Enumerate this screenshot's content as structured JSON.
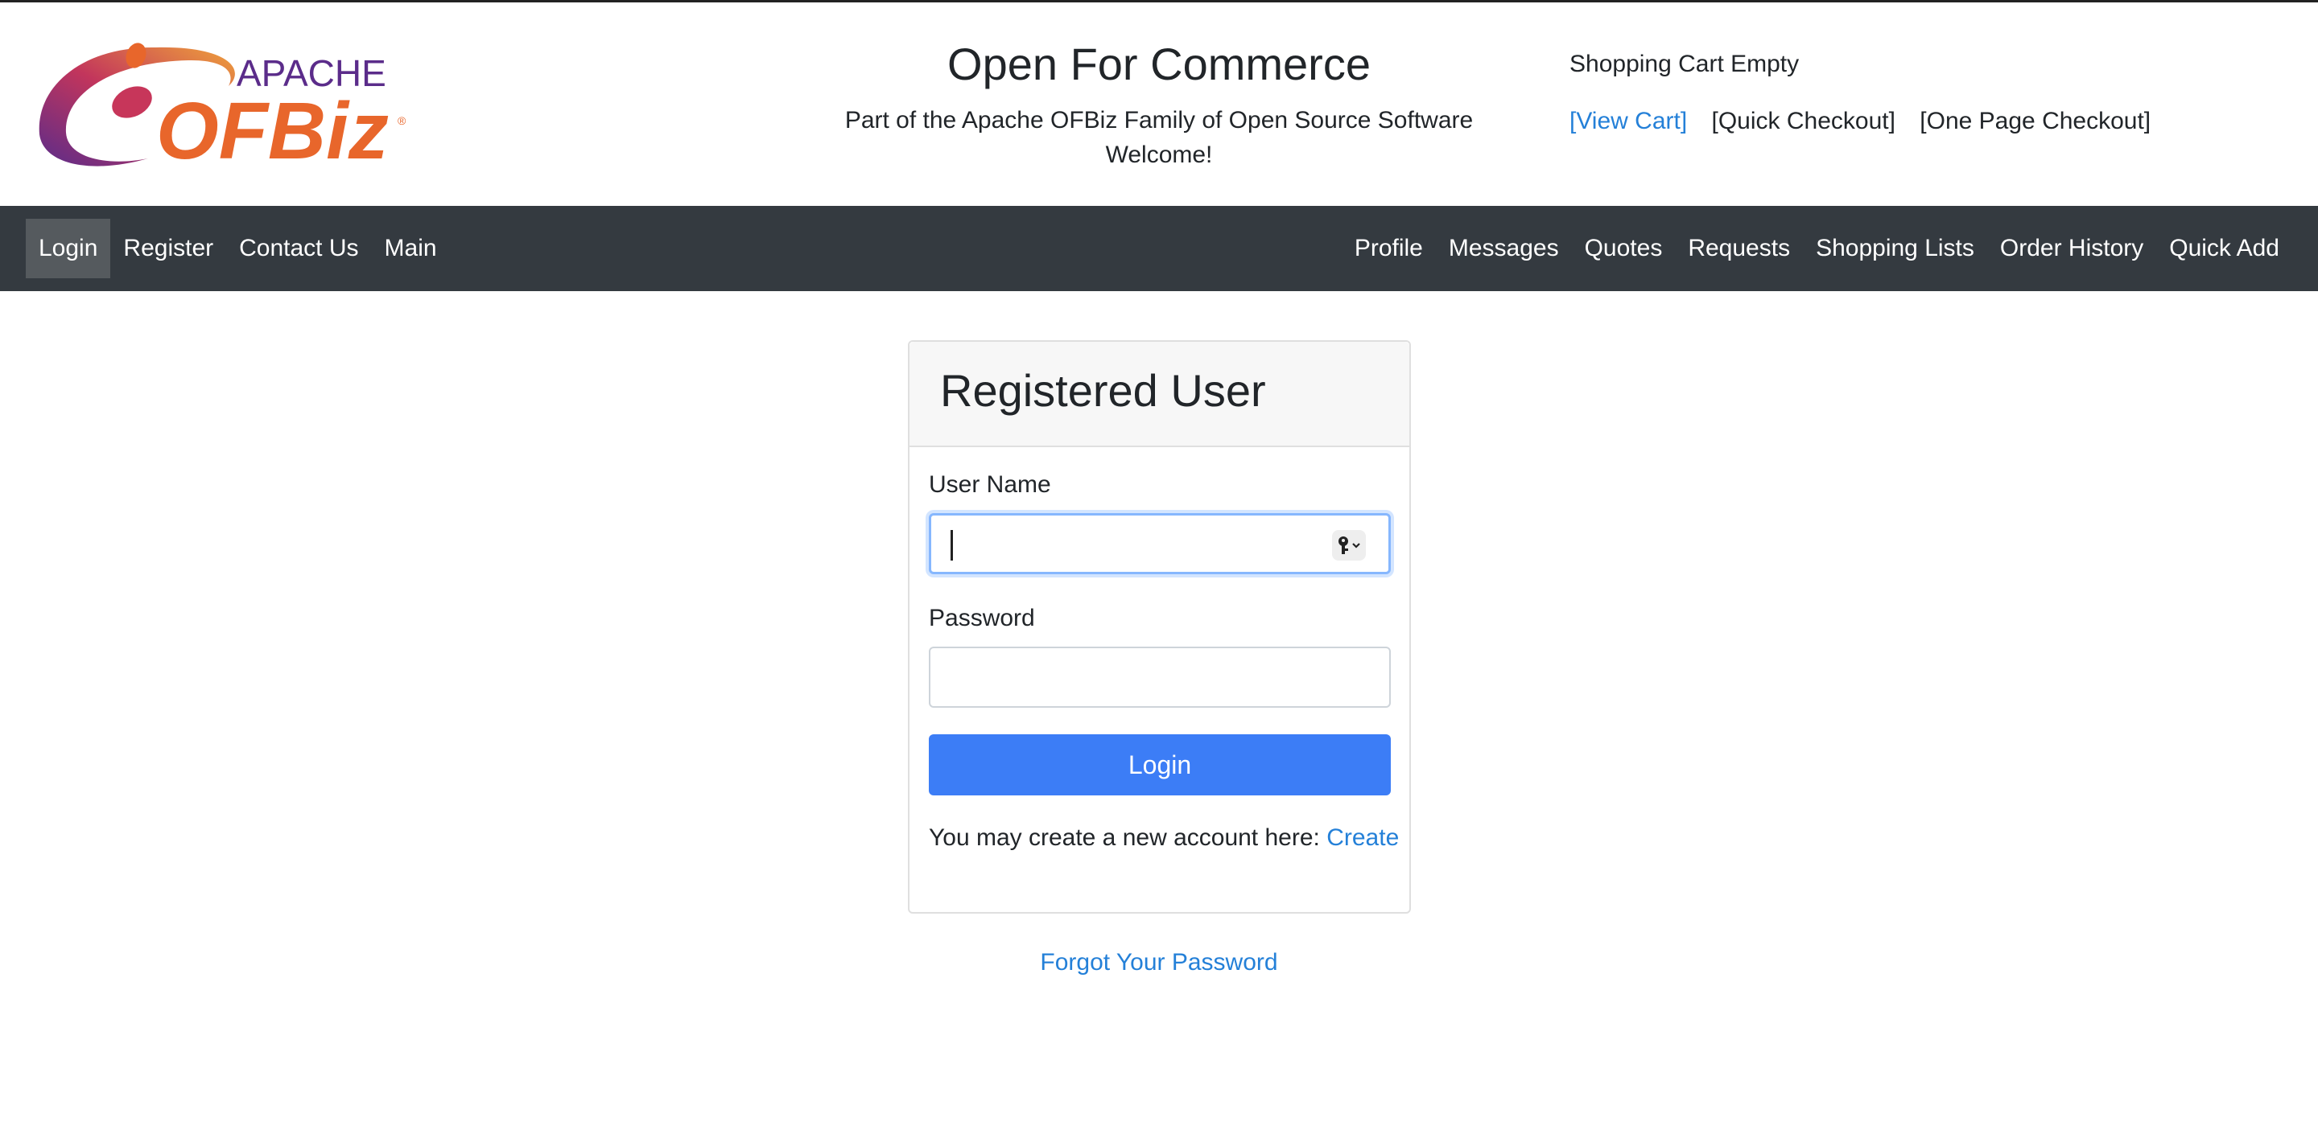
{
  "header": {
    "logo_text_top": "APACHE",
    "logo_text_bottom": "OFBiz",
    "title": "Open For Commerce",
    "tagline_line1": "Part of the Apache OFBiz Family of Open Source Software",
    "tagline_line2": "Welcome!"
  },
  "cart": {
    "status": "Shopping Cart Empty",
    "view_cart": "[View Cart]",
    "quick_checkout": "[Quick Checkout]",
    "one_page_checkout": "[One Page Checkout]"
  },
  "nav": {
    "left": [
      "Login",
      "Register",
      "Contact Us",
      "Main"
    ],
    "right": [
      "Profile",
      "Messages",
      "Quotes",
      "Requests",
      "Shopping Lists",
      "Order History",
      "Quick Add"
    ]
  },
  "login_card": {
    "title": "Registered User",
    "username_label": "User Name",
    "username_value": "",
    "password_label": "Password",
    "password_value": "",
    "login_button": "Login",
    "create_prompt": "You may create a new account here:",
    "create_link": "Create"
  },
  "forgot_password": "Forgot Your Password",
  "colors": {
    "nav_bg": "#343a40",
    "link": "#2480d8",
    "primary_button": "#3c7df6",
    "logo_orange": "#e8662b",
    "logo_purple": "#5b2c8a"
  }
}
